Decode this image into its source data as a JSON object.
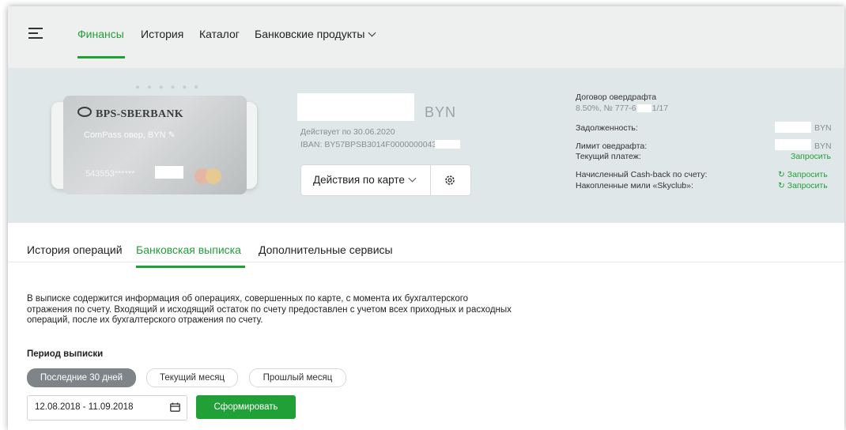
{
  "nav": {
    "items": [
      "Финансы",
      "История",
      "Каталог",
      "Банковские продукты"
    ]
  },
  "card": {
    "bank_logo": "BPS-SBERBANK",
    "name": "ComPass овер, BYN",
    "number": "543553******"
  },
  "account": {
    "currency": "BYN",
    "valid_until": "Действует по 30.06.2020",
    "iban": "IBAN: BY57BPSB3014F0000000043",
    "actions_label": "Действия по карте"
  },
  "overdraft": {
    "title": "Договор овердрафта",
    "terms_prefix": "8.50%, № 777-6",
    "terms_suffix": "1/17",
    "debt_label": "Задолженность:",
    "debt_currency": "BYN",
    "limit_label": "Лимит оведрафта:",
    "limit_currency": "BYN",
    "current_payment_label": "Текущий платеж:",
    "current_payment_action": "Запросить",
    "cashback_label": "Начисленный Cash-back по счету:",
    "cashback_action": "Запросить",
    "miles_label": "Накопленные мили «Skyclub»:",
    "miles_action": "Запросить"
  },
  "tabs": [
    "История операций",
    "Банковская выписка",
    "Дополнительные сервисы"
  ],
  "statement": {
    "description_lines": [
      "В выписке содержится информация об операциях, совершенных по карте, с момента их бухгалтерского",
      "отражения по счету. Входящий и исходящий остаток по счету предоставлен с учетом всех приходных и расходных",
      "операций, после их бухгалтерского отражения по счету."
    ],
    "period_title": "Период выписки",
    "chips": [
      "Последние 30 дней",
      "Текущий месяц",
      "Прошлый месяц"
    ],
    "date_range": "12.08.2018 - 11.09.2018",
    "submit_label": "Сформировать"
  },
  "colors": {
    "accent": "#21a038",
    "nav_bg": "#eef0f0",
    "panel_bg": "#dfe7e8",
    "chip_active": "#7e8487"
  }
}
